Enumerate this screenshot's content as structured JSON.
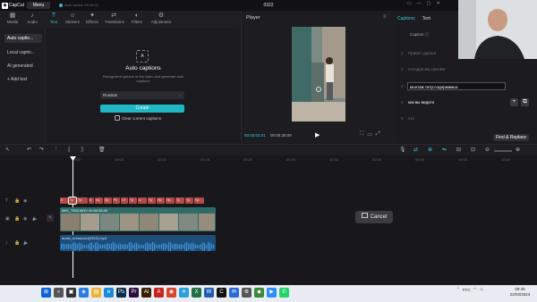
{
  "app": {
    "logo_label": "CapCut",
    "menu_label": "Menu",
    "autosave": "Auto saved: 09:43:03",
    "title": "0322",
    "window_controls": [
      "▭",
      "—",
      "▢",
      "✕"
    ]
  },
  "media_toolbar": {
    "tools": [
      {
        "label": "Media",
        "icon": "▦"
      },
      {
        "label": "Audio",
        "icon": "♪"
      },
      {
        "label": "Text",
        "icon": "T"
      },
      {
        "label": "Stickers",
        "icon": "☺"
      },
      {
        "label": "Effects",
        "icon": "✦"
      },
      {
        "label": "Transitions",
        "icon": "⇄"
      },
      {
        "label": "Filters",
        "icon": "◐"
      },
      {
        "label": "Adjustment",
        "icon": "⚙"
      }
    ]
  },
  "left_nav": {
    "items": [
      "Auto captio...",
      "Local captio...",
      "AI generated",
      "+ Add text"
    ]
  },
  "auto_captions": {
    "icon_text": "A",
    "title": "Auto captions",
    "description": "Recognized speech in the video and generate auto captions",
    "language": "Russian",
    "create_label": "Create",
    "clear_label": "Clear current captions"
  },
  "player": {
    "title": "Player",
    "menu_icon": "≡",
    "timecode": "00:00:03:01",
    "total": "00:00:35:09",
    "play_icon": "▶",
    "controls": [
      "⛶",
      "▭",
      "⤢"
    ]
  },
  "captions_panel": {
    "tabs": [
      "Captions",
      "Text"
    ],
    "subtitle": "Caption",
    "rows": [
      {
        "n": "1",
        "text": "Привет, друзья"
      },
      {
        "n": "2",
        "text": "Сегодня мы начнём"
      },
      {
        "n": "3",
        "text": "монтаж титр:содержимых"
      },
      {
        "n": "4",
        "text": "как вы видите"
      },
      {
        "n": "5",
        "text": "это"
      }
    ],
    "find_replace": "Find & Replace",
    "row_buttons": [
      "+",
      "⧉"
    ]
  },
  "timeline": {
    "ruler_ticks": [
      "00:00",
      "00:05",
      "00:10",
      "00:15",
      "00:20",
      "00:25",
      "00:30",
      "00:35",
      "00:40",
      "00:45",
      "00:50"
    ],
    "caption_clips": [
      "А",
      "Тр",
      "Пр",
      "в",
      "на",
      "Пр",
      "Рх",
      "Ст",
      "Тр",
      "А",
      "Тр",
      "Пр",
      "Пр",
      "Тр",
      "Тр",
      "Пр"
    ],
    "video_clip_label": "IMG_7526.MOV  00:00:35:09",
    "audio_clip_label": "audio_enhanced(0322).mp3",
    "cancel_label": "Cancel"
  },
  "taskbar": {
    "tray_text": "РУС",
    "time": "09:45",
    "date": "22/03/2024",
    "icons": [
      {
        "name": "windows",
        "glyph": "⊞",
        "color": "#0a64d8"
      },
      {
        "name": "search",
        "glyph": "⌕",
        "color": "#555"
      },
      {
        "name": "task-view",
        "glyph": "▣",
        "color": "#333"
      },
      {
        "name": "widgets",
        "glyph": "◈",
        "color": "#2a7de1"
      },
      {
        "name": "explorer",
        "glyph": "▤",
        "color": "#e8b53b"
      },
      {
        "name": "edge",
        "glyph": "e",
        "color": "#1d8ad9"
      },
      {
        "name": "photoshop",
        "glyph": "Ps",
        "color": "#0b2d4d"
      },
      {
        "name": "premiere",
        "glyph": "Pr",
        "color": "#2a0f3d"
      },
      {
        "name": "illustrator",
        "glyph": "Ai",
        "color": "#3a1d00"
      },
      {
        "name": "acrobat",
        "glyph": "A",
        "color": "#c8221c"
      },
      {
        "name": "chrome",
        "glyph": "◉",
        "color": "#d9442e"
      },
      {
        "name": "telegram",
        "glyph": "✈",
        "color": "#2aa0dc"
      },
      {
        "name": "excel",
        "glyph": "X",
        "color": "#1e7145"
      },
      {
        "name": "word",
        "glyph": "W",
        "color": "#1f5bb5"
      },
      {
        "name": "capcut",
        "glyph": "C",
        "color": "#111"
      },
      {
        "name": "mail",
        "glyph": "✉",
        "color": "#2a6ad6"
      },
      {
        "name": "settings",
        "glyph": "⚙",
        "color": "#555"
      },
      {
        "name": "vpn",
        "glyph": "◆",
        "color": "#3a8a3a"
      },
      {
        "name": "zoom",
        "glyph": "▶",
        "color": "#2d8cff"
      },
      {
        "name": "whatsapp",
        "glyph": "✆",
        "color": "#25d366"
      }
    ]
  }
}
